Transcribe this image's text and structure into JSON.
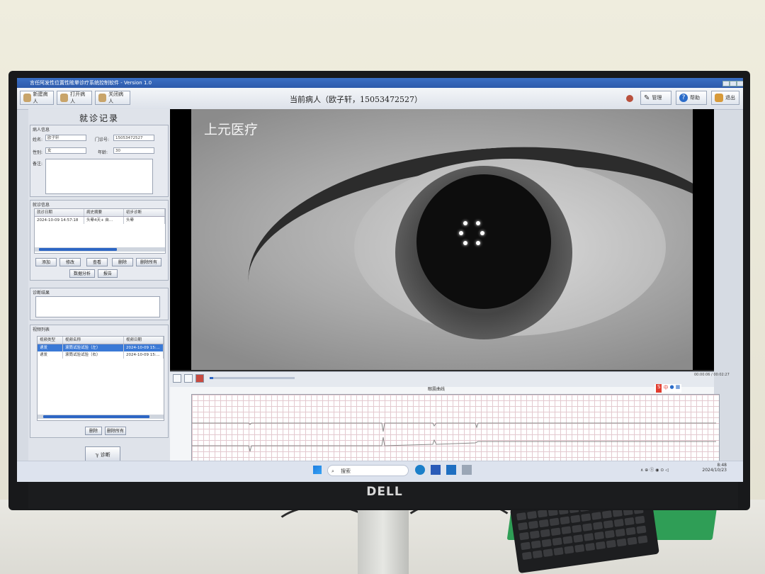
{
  "window": {
    "title": "言任阿发性位置性眩晕诊疗系统控制软件 - Version 1.0"
  },
  "toolbar": {
    "new_patient": "新建病人",
    "open_patient": "打开病人",
    "close_patient": "关闭病人",
    "current_patient": "当前病人（欧子轩，15053472527）",
    "settings": "管理",
    "help": "帮助",
    "exit": "退出"
  },
  "left_panel": {
    "title": "就诊记录",
    "patient_group": "病人信息",
    "name_label": "姓名:",
    "name_value": "欧子轩",
    "id_label": "门诊号:",
    "id_value": "15053472527",
    "gender_label": "性别:",
    "gender_value": "女",
    "age_label": "年龄:",
    "age_value": "30",
    "note_label": "备注:",
    "visit_group": "就诊信息",
    "visit_headers": [
      "就诊日期",
      "病史摘要",
      "初步诊断"
    ],
    "visit_rows": [
      [
        "2024-10-09 14:57:18",
        "头晕4天+ 自...",
        "头晕"
      ]
    ],
    "visit_buttons": [
      "添加",
      "修改",
      "查看",
      "删除",
      "删除所有"
    ],
    "data_analysis": "数据分析",
    "report": "报告",
    "diagnosis_group": "诊断结果",
    "video_group": "视频列表",
    "video_headers": [
      "视频类型",
      "视频名称",
      "视频日期"
    ],
    "video_rows": [
      [
        "诱发",
        "滚筒试验试验（左）",
        "2024-10-09 15:..."
      ],
      [
        "诱发",
        "滚筒试验试验（右）",
        "2024-10-09 15:..."
      ]
    ],
    "video_delete": "删除",
    "video_delete_all": "删除所有",
    "treat_button": "诊断"
  },
  "video": {
    "watermark": "上元医疗",
    "time": "00:00:06 / 00:02:27",
    "progress": 0.04,
    "waveform_title": "眼震曲线"
  },
  "ime": {
    "label": "中"
  },
  "taskbar": {
    "search_placeholder": "搜索",
    "time": "8:48",
    "date": "2024/10/23"
  },
  "monitor": {
    "brand": "DELL"
  },
  "colors": {
    "accent": "#2c5aab",
    "selection": "#3a79d6",
    "waveform_grid": "#e3c9cf"
  }
}
